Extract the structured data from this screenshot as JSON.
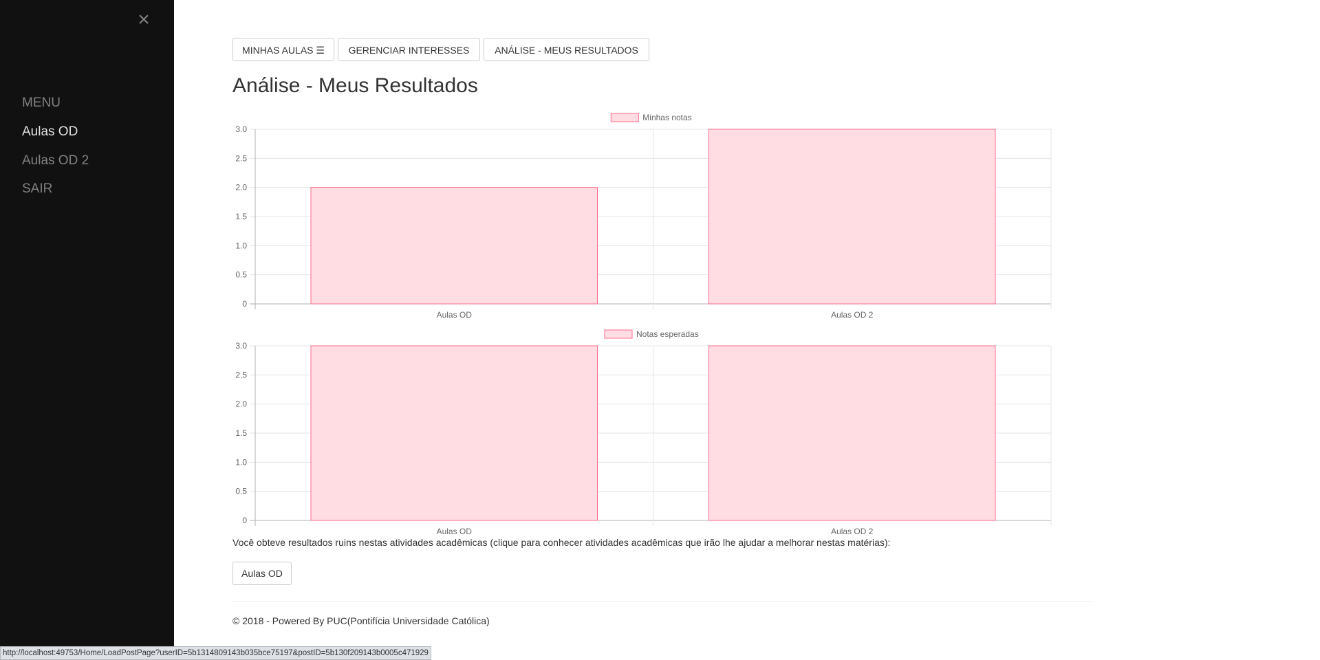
{
  "sidebar": {
    "close_label": "×",
    "items": [
      {
        "label": "MENU"
      },
      {
        "label": "Aulas OD"
      },
      {
        "label": "Aulas OD 2"
      },
      {
        "label": "SAIR"
      }
    ]
  },
  "nav": {
    "minhas_aulas": "MINHAS AULAS ☰",
    "gerenciar": "GERENCIAR INTERESSES",
    "analise": "ANÁLISE - MEUS RESULTADOS"
  },
  "page_title": "Análise - Meus Resultados",
  "colors": {
    "bar_fill": "#ffdde3",
    "bar_stroke": "#ff6b8a",
    "grid": "#e5e5e5",
    "axis": "#b0b0b0",
    "text": "#666666"
  },
  "chart_data": [
    {
      "type": "bar",
      "categories": [
        "Aulas OD",
        "Aulas OD 2"
      ],
      "series": [
        {
          "name": "Minhas notas",
          "values": [
            2,
            3
          ]
        }
      ],
      "ylim": [
        0,
        3
      ],
      "yticks": [
        "0",
        "0.5",
        "1.0",
        "1.5",
        "2.0",
        "2.5",
        "3.0"
      ],
      "grid": true,
      "legend": "top-center"
    },
    {
      "type": "bar",
      "categories": [
        "Aulas OD",
        "Aulas OD 2"
      ],
      "series": [
        {
          "name": "Notas esperadas",
          "values": [
            3,
            3
          ]
        }
      ],
      "ylim": [
        0,
        3
      ],
      "yticks": [
        "0",
        "0.5",
        "1.0",
        "1.5",
        "2.0",
        "2.5",
        "3.0"
      ],
      "grid": true,
      "legend": "top-center"
    }
  ],
  "message": "Você obteve resultados ruins nestas atividades acadêmicas (clique para conhecer atividades acadêmicas que irão lhe ajudar a melhorar nestas matérias):",
  "result_button": "Aulas OD",
  "footer": "© 2018 - Powered By PUC(Pontifícia Universidade Católica)",
  "status_url": "http://localhost:49753/Home/LoadPostPage?userID=5b1314809143b035bce75197&postID=5b130f209143b0005c471929"
}
